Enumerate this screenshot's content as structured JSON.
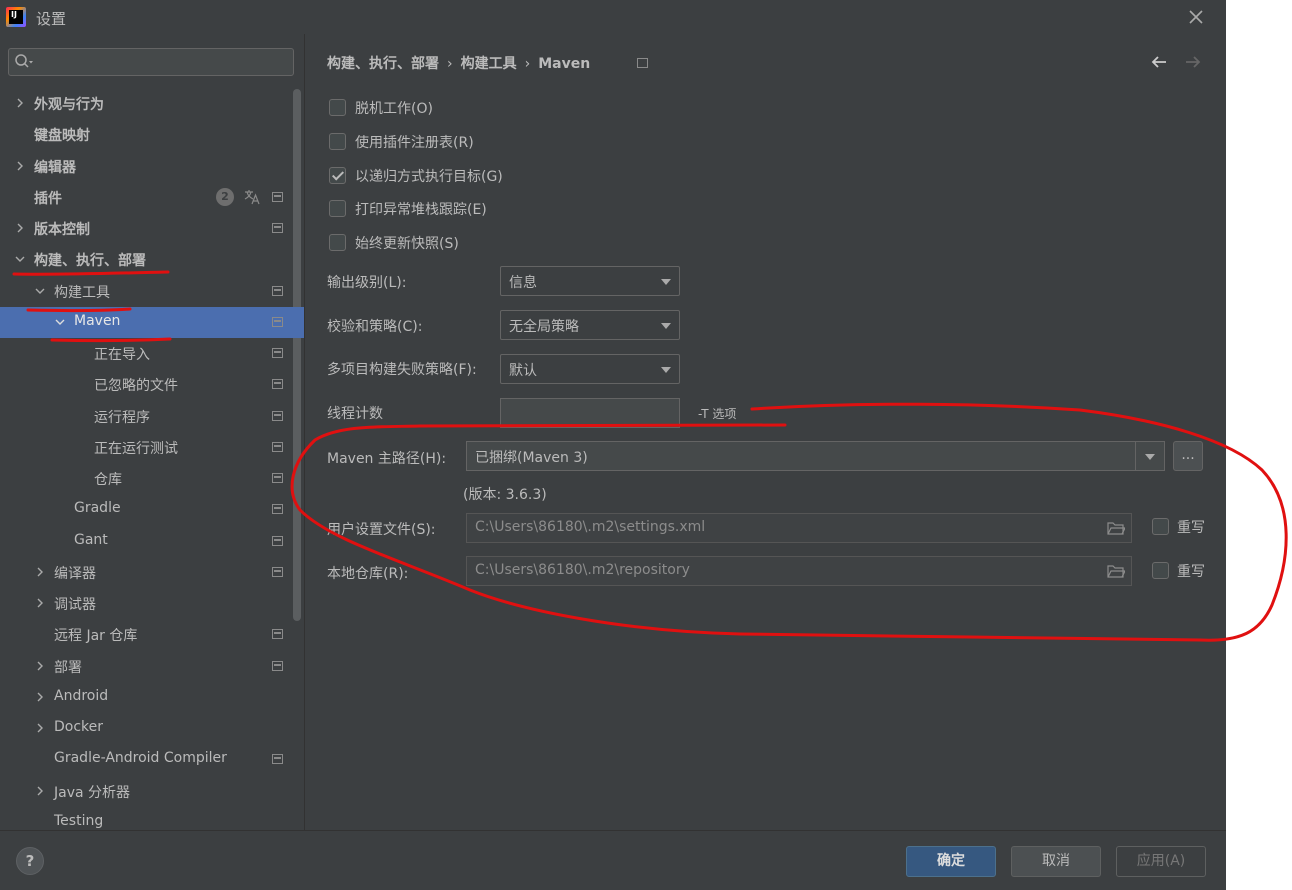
{
  "window": {
    "title": "设置"
  },
  "search": {
    "placeholder": "",
    "value": ""
  },
  "sidebar": {
    "items": [
      {
        "label": "外观与行为"
      },
      {
        "label": "键盘映射"
      },
      {
        "label": "编辑器"
      },
      {
        "label": "插件",
        "badge": "2"
      },
      {
        "label": "版本控制"
      },
      {
        "label": "构建、执行、部署"
      },
      {
        "label": "构建工具"
      },
      {
        "label": "Maven"
      },
      {
        "label": "正在导入"
      },
      {
        "label": "已忽略的文件"
      },
      {
        "label": "运行程序"
      },
      {
        "label": "正在运行测试"
      },
      {
        "label": "仓库"
      },
      {
        "label": "Gradle"
      },
      {
        "label": "Gant"
      },
      {
        "label": "编译器"
      },
      {
        "label": "调试器"
      },
      {
        "label": "远程 Jar 仓库"
      },
      {
        "label": "部署"
      },
      {
        "label": "Android"
      },
      {
        "label": "Docker"
      },
      {
        "label": "Gradle-Android Compiler"
      },
      {
        "label": "Java 分析器"
      },
      {
        "label": "Testing"
      }
    ]
  },
  "breadcrumb": {
    "part1": "构建、执行、部署",
    "sep": "›",
    "part2": "构建工具",
    "part3": "Maven"
  },
  "options": {
    "offline": {
      "label": "脱机工作(O)",
      "checked": false
    },
    "plugin_registry": {
      "label": "使用插件注册表(R)",
      "checked": false
    },
    "recursive": {
      "label": "以递归方式执行目标(G)",
      "checked": true
    },
    "print_stacktrace": {
      "label": "打印异常堆栈跟踪(E)",
      "checked": false
    },
    "always_update": {
      "label": "始终更新快照(S)",
      "checked": false
    }
  },
  "fields": {
    "output_level": {
      "label": "输出级别(L):",
      "value": "信息"
    },
    "checksum_policy": {
      "label": "校验和策略(C):",
      "value": "无全局策略"
    },
    "fail_policy": {
      "label": "多项目构建失败策略(F):",
      "value": "默认"
    },
    "thread_count": {
      "label": "线程计数",
      "value": "",
      "hint": "-T 选项"
    },
    "maven_home": {
      "label": "Maven 主路径(H):",
      "value": "已捆绑(Maven 3)",
      "browse": "...",
      "version": "(版本: 3.6.3)"
    },
    "user_settings": {
      "label": "用户设置文件(S):",
      "value": "C:\\Users\\86180\\.m2\\settings.xml",
      "override": "重写"
    },
    "local_repo": {
      "label": "本地仓库(R):",
      "value": "C:\\Users\\86180\\.m2\\repository",
      "override": "重写"
    }
  },
  "buttons": {
    "help": "?",
    "ok": "确定",
    "cancel": "取消",
    "apply": "应用(A)"
  },
  "colors": {
    "background": "#3c3f41",
    "selection": "#4b6eaf",
    "primary_button": "#365880",
    "annotation": "#e01010"
  }
}
